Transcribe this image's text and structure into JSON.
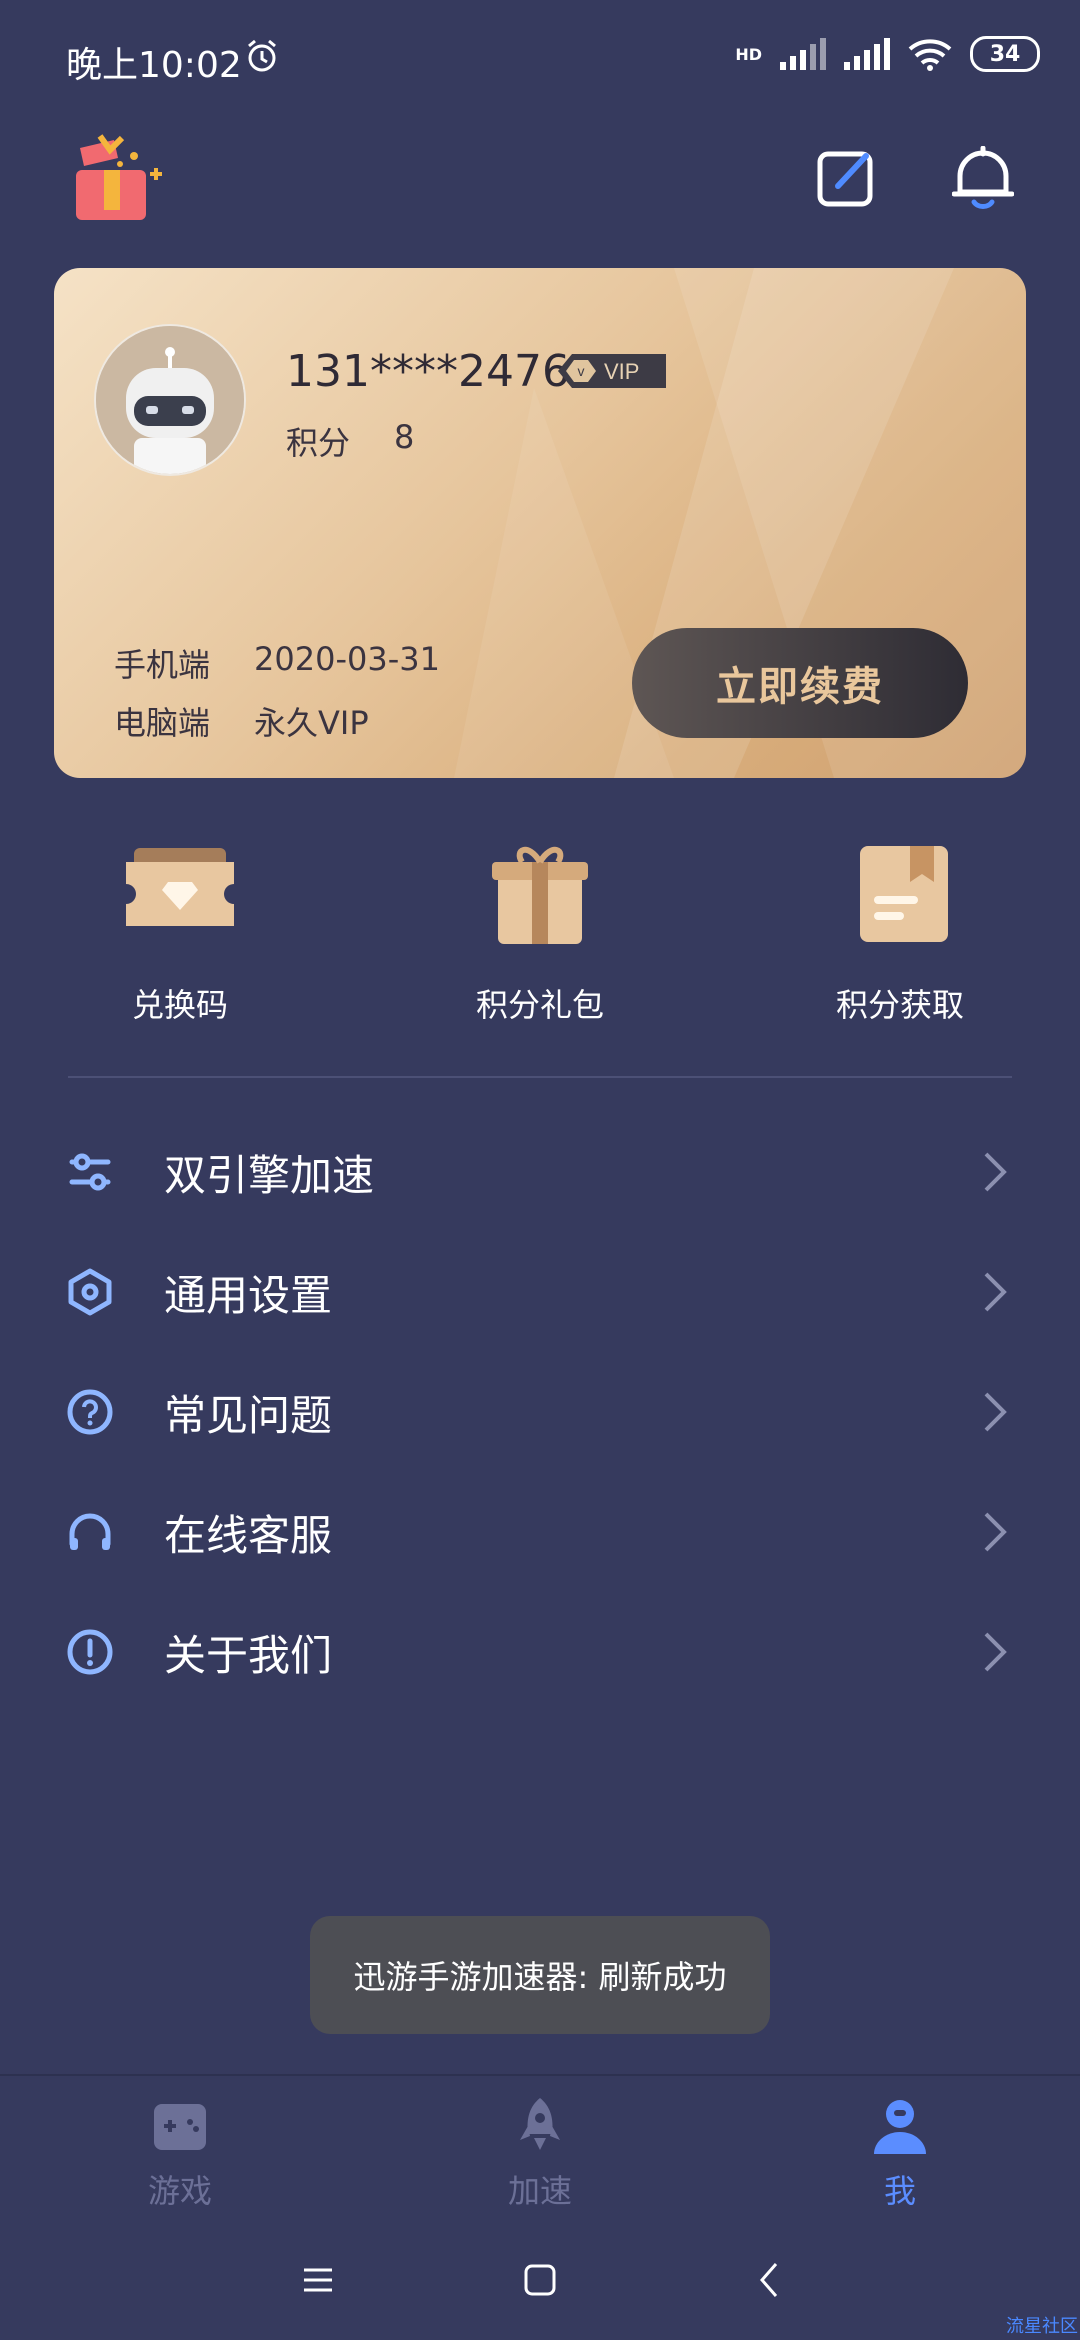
{
  "status_bar": {
    "time": "晚上10:02",
    "network": "HD",
    "battery": "34"
  },
  "vip_card": {
    "phone": "131****2476",
    "badge": "VIP",
    "badge_short": "v",
    "points_label": "积分",
    "points_value": "8",
    "mobile_label": "手机端",
    "mobile_value": "2020-03-31",
    "pc_label": "电脑端",
    "pc_value": "永久VIP",
    "renew_label": "立即续费"
  },
  "quick_actions": [
    {
      "label": "兑换码",
      "icon": "ticket-icon"
    },
    {
      "label": "积分礼包",
      "icon": "gift-box-icon"
    },
    {
      "label": "积分获取",
      "icon": "bookmark-book-icon"
    }
  ],
  "menu": [
    {
      "label": "双引擎加速",
      "icon": "dual-engine-icon"
    },
    {
      "label": "通用设置",
      "icon": "hexagon-settings-icon"
    },
    {
      "label": "常见问题",
      "icon": "question-icon"
    },
    {
      "label": "在线客服",
      "icon": "headset-icon"
    },
    {
      "label": "关于我们",
      "icon": "info-icon"
    }
  ],
  "toast": "迅游手游加速器: 刷新成功",
  "tabs": [
    {
      "label": "游戏",
      "icon": "gamepad-icon",
      "active": false
    },
    {
      "label": "加速",
      "icon": "rocket-icon",
      "active": false
    },
    {
      "label": "我",
      "icon": "user-icon",
      "active": true
    }
  ],
  "colors": {
    "background": "#363a5e",
    "accent": "#5b8dff",
    "card_gold": "#e6c59c",
    "menu_icon": "#8fb6ff"
  },
  "watermark": "流星社区"
}
